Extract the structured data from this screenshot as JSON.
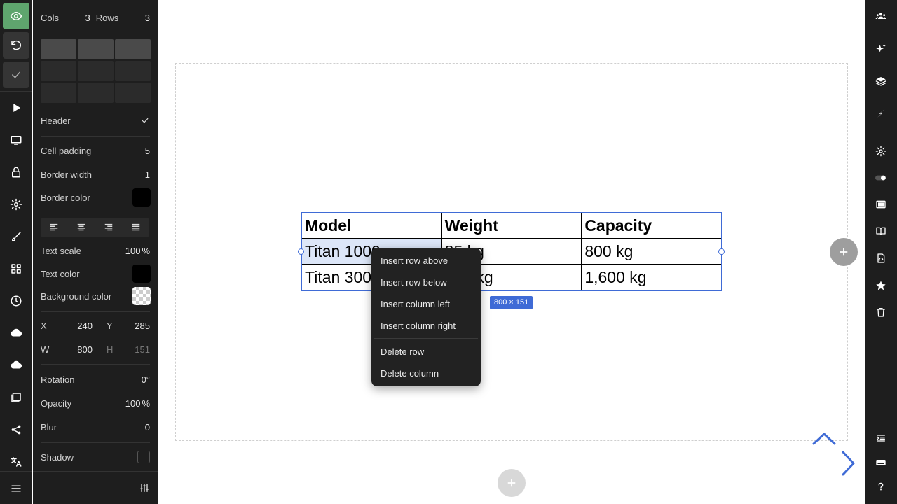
{
  "panel": {
    "cols_label": "Cols",
    "cols_value": "3",
    "rows_label": "Rows",
    "rows_value": "3",
    "header_label": "Header",
    "cell_padding_label": "Cell padding",
    "cell_padding_value": "5",
    "border_width_label": "Border width",
    "border_width_value": "1",
    "border_color_label": "Border color",
    "border_color": "#000000",
    "text_scale_label": "Text scale",
    "text_scale_value": "100",
    "text_scale_unit": "%",
    "text_color_label": "Text color",
    "text_color": "#000000",
    "background_color_label": "Background color",
    "x_label": "X",
    "x_value": "240",
    "y_label": "Y",
    "y_value": "285",
    "w_label": "W",
    "w_value": "800",
    "h_label": "H",
    "h_value": "151",
    "rotation_label": "Rotation",
    "rotation_value": "0°",
    "opacity_label": "Opacity",
    "opacity_value": "100",
    "opacity_unit": "%",
    "blur_label": "Blur",
    "blur_value": "0",
    "shadow_label": "Shadow"
  },
  "table": {
    "header": [
      "Model",
      "Weight",
      "Capacity"
    ],
    "rows": [
      [
        "Titan 1000",
        "85 kg",
        "800 kg"
      ],
      [
        "Titan 3000",
        "140 kg",
        "1,600 kg"
      ]
    ]
  },
  "selection": {
    "size_badge": "800 × 151"
  },
  "context_menu": {
    "items": [
      "Insert row above",
      "Insert row below",
      "Insert column left",
      "Insert column right",
      "Delete row",
      "Delete column"
    ]
  },
  "colors": {
    "accent": "#3f6bd6",
    "preview_green": "#5fa56e",
    "panel_bg": "#1e1e1e"
  },
  "icons": {
    "left_rail": [
      "eye-icon",
      "undo-icon",
      "check-icon",
      "play-icon",
      "monitor-icon",
      "lock-icon",
      "gear-icon",
      "brush-icon",
      "grid-icon",
      "clock-icon",
      "cloud-upload-icon",
      "cloud-download-icon",
      "image-icon",
      "share-icon",
      "translate-icon",
      "menu-icon"
    ],
    "right_rail": [
      "users-icon",
      "sparkle-icon",
      "layers-icon",
      "lightning-icon",
      "gear-icon",
      "toggle-icon",
      "frame-icon",
      "book-icon",
      "code-file-icon",
      "star-icon",
      "trash-icon",
      "indent-icon",
      "keyboard-icon",
      "help-icon"
    ]
  }
}
